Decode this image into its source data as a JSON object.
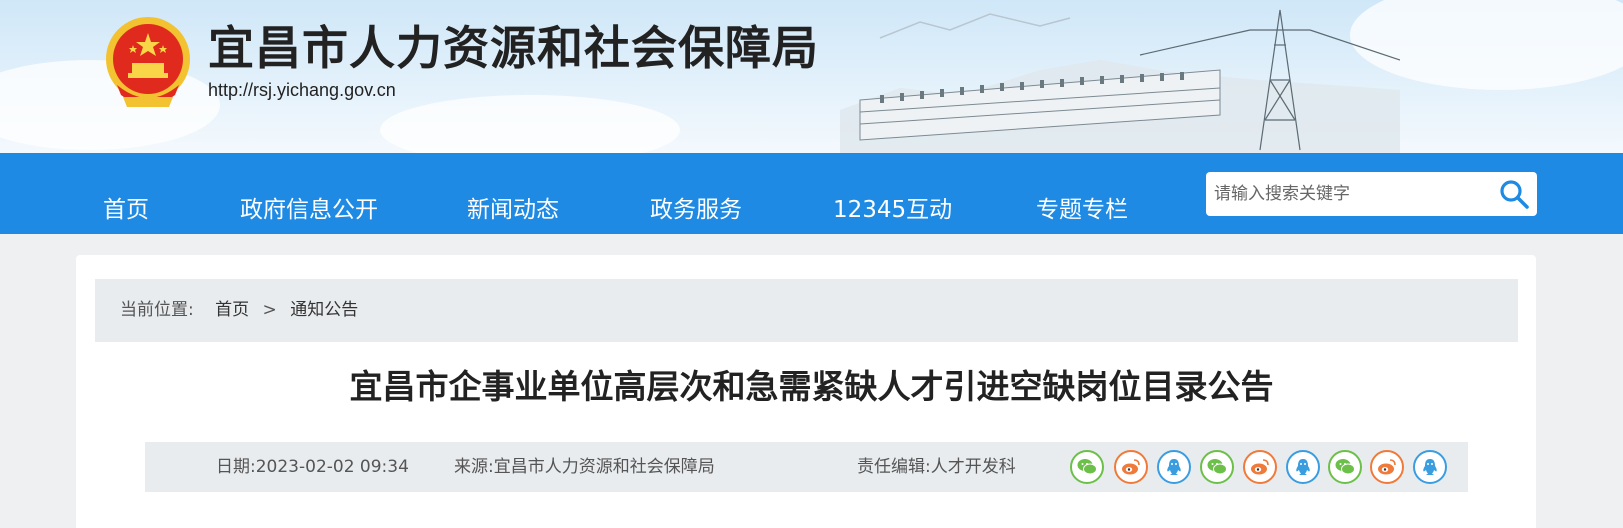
{
  "header": {
    "site_title": "宜昌市人力资源和社会保障局",
    "site_url": "http://rsj.yichang.gov.cn"
  },
  "nav": {
    "items": [
      {
        "label": "首页"
      },
      {
        "label": "政府信息公开"
      },
      {
        "label": "新闻动态"
      },
      {
        "label": "政务服务"
      },
      {
        "label": "12345互动"
      },
      {
        "label": "专题专栏"
      }
    ]
  },
  "search": {
    "placeholder": "请输入搜索关键字",
    "icon": "search-icon"
  },
  "breadcrumb": {
    "label": "当前位置:",
    "home": "首页",
    "separator": ">",
    "current": "通知公告"
  },
  "article": {
    "title": "宜昌市企事业单位高层次和急需紧缺人才引进空缺岗位目录公告",
    "date": "日期:2023-02-02 09:34",
    "source": "来源:宜昌市人力资源和社会保障局",
    "editor": "责任编辑:人才开发科"
  },
  "share": {
    "icons": [
      "wechat-icon",
      "weibo-icon",
      "qq-icon",
      "wechat-icon",
      "weibo-icon",
      "qq-icon",
      "wechat-icon",
      "weibo-icon",
      "qq-icon"
    ]
  },
  "colors": {
    "nav_bg": "#1f8ae3",
    "wechat": "#6cc04a",
    "weibo": "#f07a3a",
    "qq": "#3a9de0"
  }
}
